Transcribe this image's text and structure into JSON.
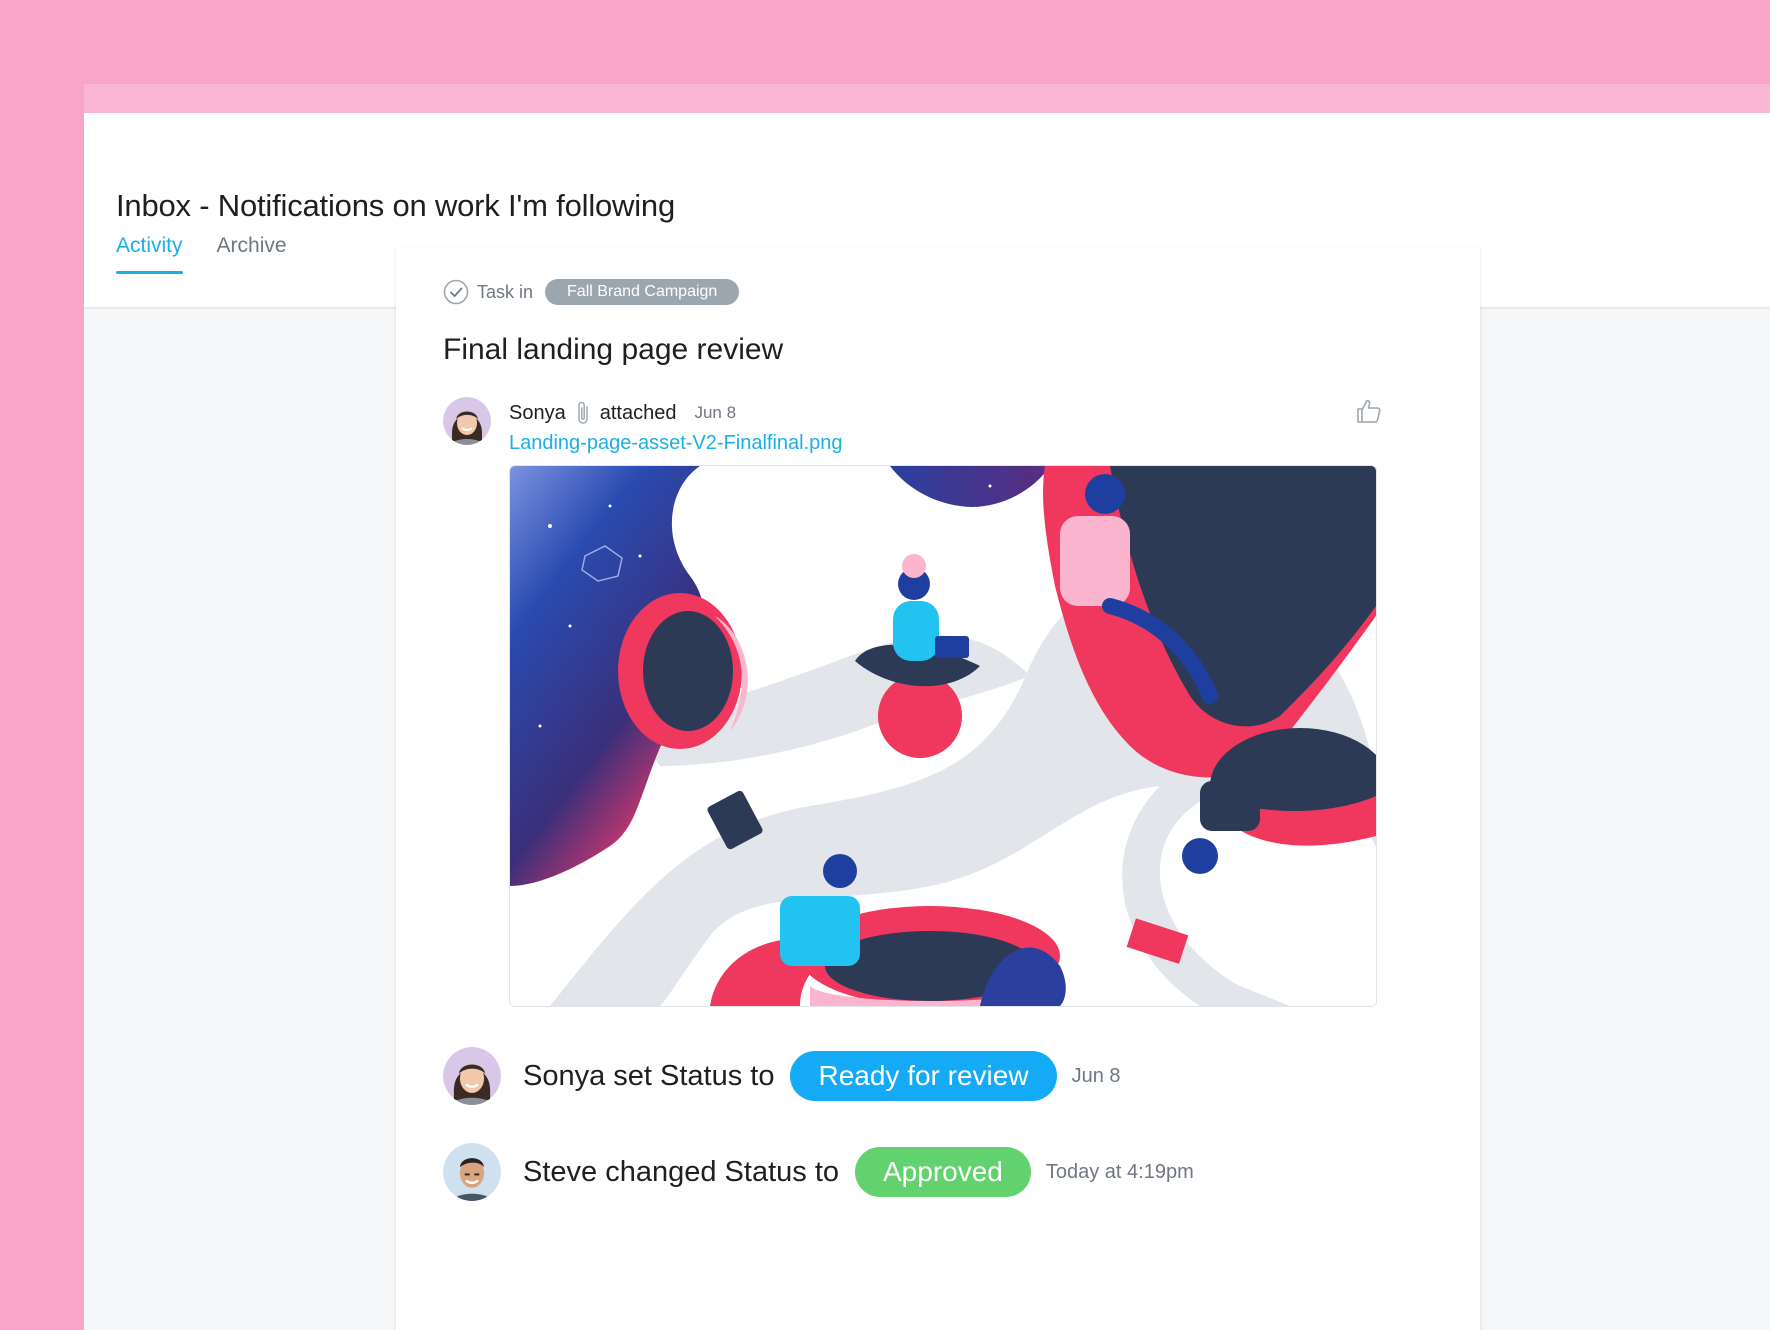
{
  "header": {
    "title": "Inbox - Notifications on work I'm following",
    "tabs": [
      {
        "label": "Activity",
        "active": true
      },
      {
        "label": "Archive",
        "active": false
      }
    ]
  },
  "card": {
    "task_prefix": "Task in",
    "project": "Fall Brand Campaign",
    "title": "Final landing page review",
    "attachment_story": {
      "user": "Sonya",
      "action": "attached",
      "date": "Jun 8",
      "file_name": "Landing-page-asset-V2-Finalfinal.png"
    },
    "status_stories": [
      {
        "text": "Sonya set Status to",
        "status": "Ready for review",
        "status_color": "#14aaf5",
        "date": "Jun 8"
      },
      {
        "text": "Steve changed Status to",
        "status": "Approved",
        "status_color": "#62d26f",
        "date": "Today at 4:19pm"
      }
    ]
  },
  "colors": {
    "background_pink": "#f8a6c8",
    "accent_blue": "#1aafe6",
    "approved_green": "#62d26f"
  },
  "icons": [
    "check-circle-icon",
    "paperclip-icon",
    "thumbs-up-icon"
  ]
}
